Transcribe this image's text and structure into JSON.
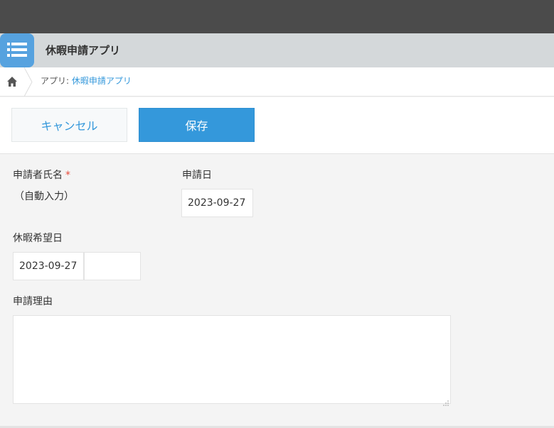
{
  "topbar": {
    "icons": [
      "menu-icon",
      "home-icon",
      "bell-icon",
      "star-icon"
    ]
  },
  "app": {
    "title": "休暇申請アプリ",
    "icon": "list-icon",
    "accent": "#56a2df"
  },
  "breadcrumb": {
    "prefix": "アプリ: ",
    "app_link": "休暇申請アプリ"
  },
  "actions": {
    "cancel_label": "キャンセル",
    "save_label": "保存"
  },
  "form": {
    "applicant_label": "申請者氏名",
    "required_mark": "*",
    "applicant_value": "（自動入力）",
    "apply_date_label": "申請日",
    "apply_date_value": "2023-09-27",
    "leave_date_label": "休暇希望日",
    "leave_date_value": "2023-09-27",
    "leave_time_value": "",
    "reason_label": "申請理由",
    "reason_value": ""
  },
  "colors": {
    "topbar": "#4b4b4b",
    "header": "#d4d8da",
    "primary": "#3498db",
    "required": "#e74c3c"
  }
}
